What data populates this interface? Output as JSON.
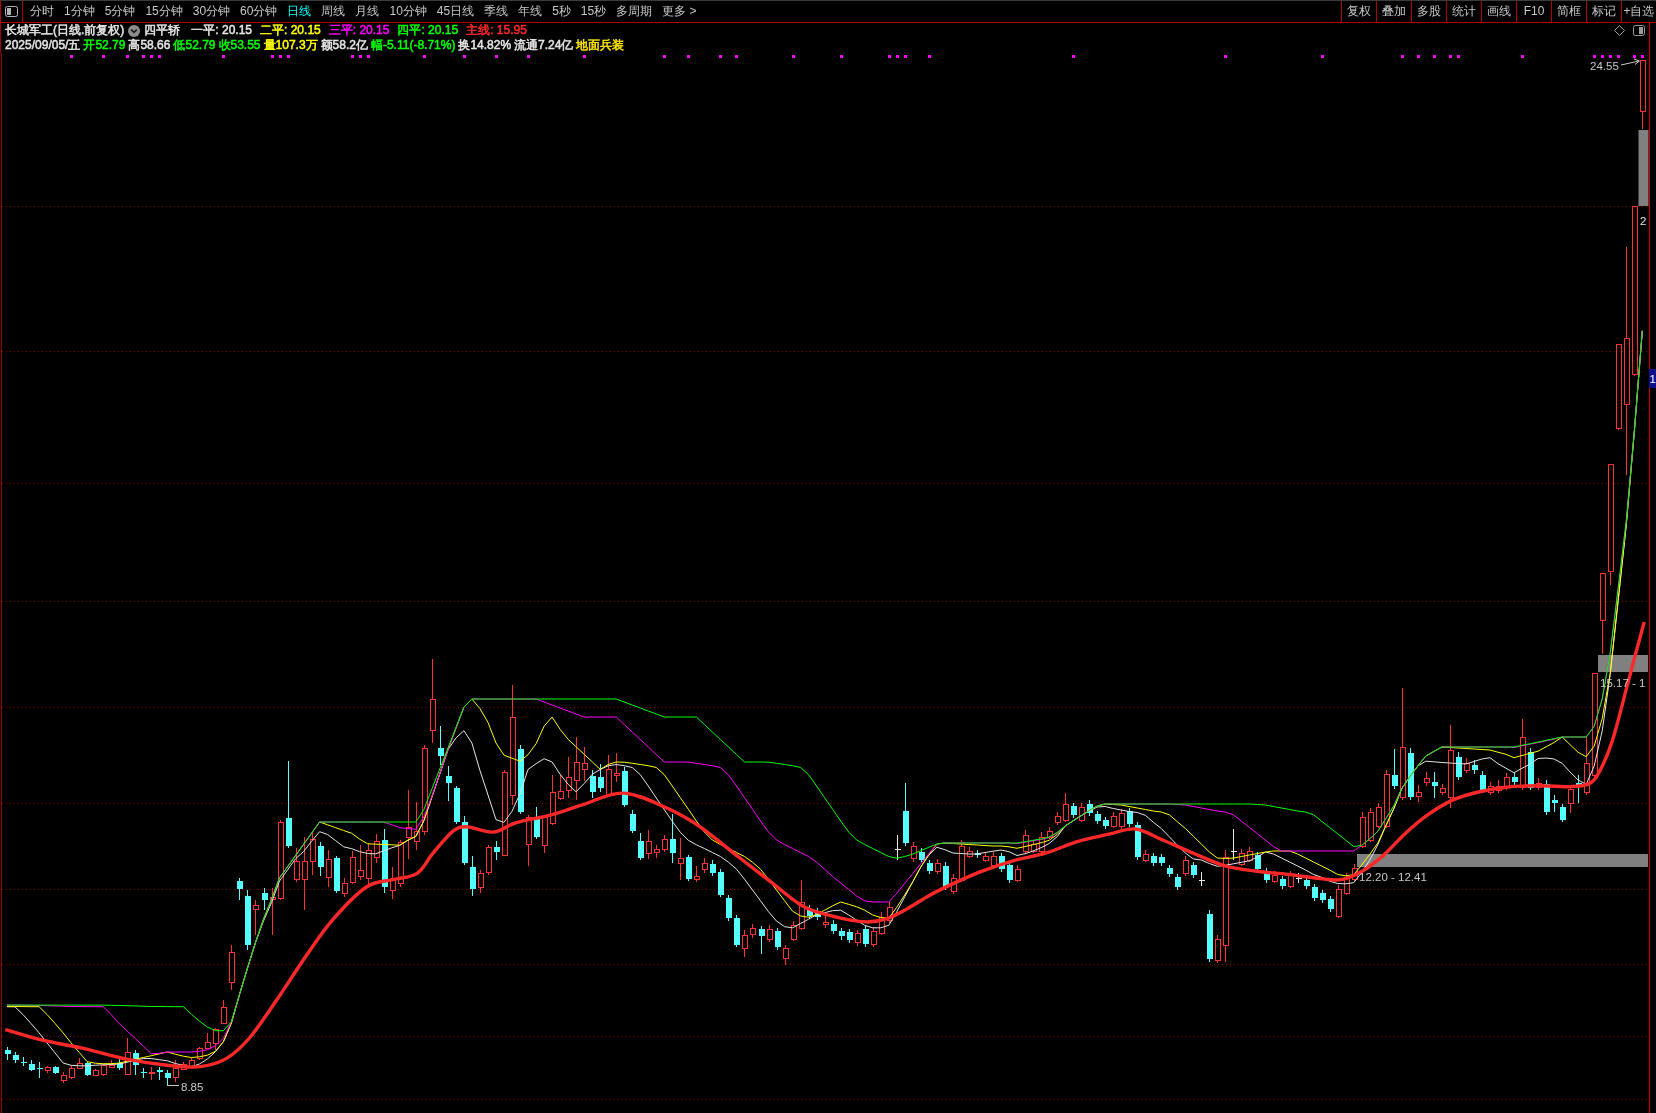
{
  "toolbar": {
    "tabs": [
      {
        "label": "分时",
        "selected": false
      },
      {
        "label": "1分钟",
        "selected": false
      },
      {
        "label": "5分钟",
        "selected": false
      },
      {
        "label": "15分钟",
        "selected": false
      },
      {
        "label": "30分钟",
        "selected": false
      },
      {
        "label": "60分钟",
        "selected": false
      },
      {
        "label": "日线",
        "selected": true
      },
      {
        "label": "周线",
        "selected": false
      },
      {
        "label": "月线",
        "selected": false
      },
      {
        "label": "10分钟",
        "selected": false
      },
      {
        "label": "45日线",
        "selected": false
      },
      {
        "label": "季线",
        "selected": false
      },
      {
        "label": "年线",
        "selected": false
      },
      {
        "label": "5秒",
        "selected": false
      },
      {
        "label": "15秒",
        "selected": false
      },
      {
        "label": "多周期",
        "selected": false
      },
      {
        "label": "更多 >",
        "selected": false
      }
    ],
    "buttons": [
      "复权",
      "叠加",
      "多股",
      "统计",
      "画线",
      "F10",
      "简框",
      "标记",
      "+自选"
    ]
  },
  "header": {
    "title": "长城军工(日线.前复权)",
    "indicator": "四平轿",
    "legend": [
      {
        "label": "一平: 20.15",
        "color": "#e6e6e6"
      },
      {
        "label": "二平: 20.15",
        "color": "#ffff00"
      },
      {
        "label": "三平: 20.15",
        "color": "#ff00ff"
      },
      {
        "label": "四平: 20.15",
        "color": "#00ff00"
      },
      {
        "label": "主线: 15.95",
        "color": "#ff2828"
      }
    ]
  },
  "quote": [
    {
      "text": "2025/09/05/五",
      "color": "#e6e6e6"
    },
    {
      "text": "开52.79",
      "color": "#00ff00"
    },
    {
      "text": "高58.66",
      "color": "#e6e6e6"
    },
    {
      "text": "低52.79",
      "color": "#00ff00"
    },
    {
      "text": "收53.55",
      "color": "#00ff00"
    },
    {
      "text": "量107.3万",
      "color": "#ffff00"
    },
    {
      "text": "额58.2亿",
      "color": "#e6e6e6"
    },
    {
      "text": "幅-5.11(-8.71%)",
      "color": "#00ff00"
    },
    {
      "text": "换14.82%",
      "color": "#e6e6e6"
    },
    {
      "text": "流通7.24亿",
      "color": "#e6e6e6"
    },
    {
      "text": "地面兵装",
      "color": "#ffe600"
    }
  ],
  "chart": {
    "high_label": "24.55",
    "low_label": "8.85",
    "bands": [
      "15.17 - 1",
      "12.20 - 12.41"
    ],
    "axis_labels": [
      {
        "text": "2",
        "kind": "plain"
      },
      {
        "text": "1",
        "kind": "tag"
      }
    ]
  }
}
